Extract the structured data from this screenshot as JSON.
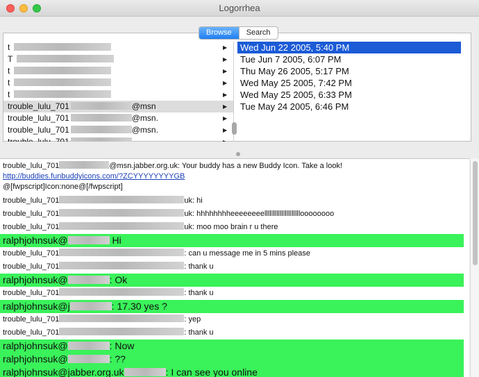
{
  "window": {
    "title": "Logorrhea"
  },
  "toolbar": {
    "tabs": [
      "Browse",
      "Search"
    ],
    "active_tab": "Browse"
  },
  "buddies": [
    {
      "label": "t",
      "selected": false
    },
    {
      "label": "T",
      "selected": false
    },
    {
      "label": "t",
      "selected": false
    },
    {
      "label": "t",
      "selected": false
    },
    {
      "label": "t",
      "selected": false
    },
    {
      "label": "trouble_lulu_701",
      "suffix": "@msn",
      "selected": true
    },
    {
      "label": "trouble_lulu_701",
      "suffix": "@msn.",
      "selected": false
    },
    {
      "label": "trouble_lulu_701",
      "suffix": "@msn.",
      "selected": false
    },
    {
      "label": "trouble_lulu_701",
      "suffix": "",
      "selected": false
    }
  ],
  "dates": [
    "Wed Jun 22 2005, 5:40 PM",
    "Tue Jun 7 2005, 6:07 PM",
    "Thu May 26 2005, 5:17 PM",
    "Wed May 25 2005, 7:42 PM",
    "Wed May 25 2005, 6:33 PM",
    "Tue May 24 2005, 6:46 PM"
  ],
  "log": {
    "first": {
      "prefix": "trouble_lulu_701",
      "text": "@msn.jabber.org.uk: Your buddy has a new Buddy Icon. Take a look! ",
      "link": "http://buddies.funbuddyicons.com/?ZCYYYYYYYYGB",
      "cmd": "@[fwpscript]Icon:none@[/fwpscript]"
    },
    "lines": [
      {
        "who": "trouble_lulu_701",
        "tail": "uk: hi",
        "green": false
      },
      {
        "who": "trouble_lulu_701",
        "tail": "uk: hhhhhhhheeeeeeeellllllllllllllllllllloooooooo",
        "green": false
      },
      {
        "who": "trouble_lulu_701",
        "tail": "uk: moo moo brain r u there",
        "green": false
      },
      {
        "who": "ralphjohnsuk@",
        "tail": "Hi",
        "green": true
      },
      {
        "who": "trouble_lulu_701",
        "tail": ": can u message me in 5 mins please",
        "green": false
      },
      {
        "who": "trouble_lulu_701",
        "tail": ": thank u",
        "green": false
      },
      {
        "who": "ralphjohnsuk@",
        "tail": ": Ok",
        "green": true
      },
      {
        "who": "trouble_lulu_701",
        "tail": ": thank u",
        "green": false
      },
      {
        "who": "ralphjohnsuk@j",
        "tail": ": 17.30 yes ?",
        "green": true
      },
      {
        "who": "trouble_lulu_701",
        "tail": ": yep",
        "green": false
      },
      {
        "who": "trouble_lulu_701",
        "tail": ": thank u",
        "green": false
      },
      {
        "who": "ralphjohnsuk@",
        "tail": ": Now",
        "green": true
      },
      {
        "who": "ralphjohnsuk@",
        "tail": ": ??",
        "green": true
      },
      {
        "who": "ralphjohnsuk@jabber.org.uk",
        "tail": ": I can see you online",
        "green": true
      }
    ]
  },
  "colors": {
    "selection": "#1b5bd6",
    "self_line": "#3af25a",
    "link": "#1a3fbb"
  }
}
